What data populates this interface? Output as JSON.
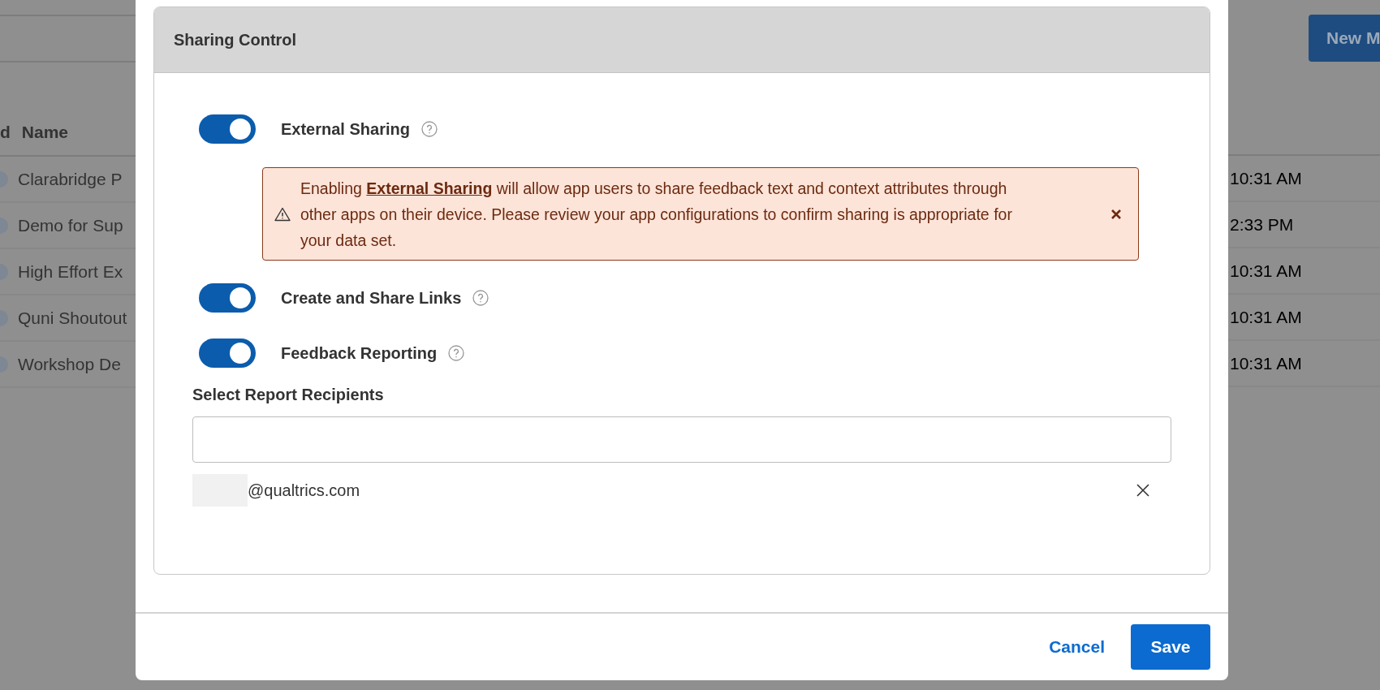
{
  "background": {
    "header_cells": [
      "d",
      "Name"
    ],
    "new_button": "New M",
    "rows": [
      {
        "name": "Clarabridge P",
        "time": "10:31 AM"
      },
      {
        "name": "Demo for Sup",
        "time": "2:33 PM"
      },
      {
        "name": "High Effort Ex",
        "time": "10:31 AM"
      },
      {
        "name": "Quni Shoutout",
        "time": "10:31 AM"
      },
      {
        "name": "Workshop De",
        "time": "10:31 AM"
      }
    ]
  },
  "dialog": {
    "card_title": "Sharing Control",
    "toggles": [
      {
        "label": "External Sharing",
        "on": true,
        "alert": "Enabling **External Sharing** will allow app users to share feedback text and context attributes through other apps on their device. Please review your app configurations to confirm sharing is appropriate for your data set."
      },
      {
        "label": "Create and Share Links",
        "on": true
      },
      {
        "label": "Feedback Reporting",
        "on": true
      }
    ],
    "recipients": {
      "label": "Select Report Recipients",
      "emails": [
        "@qualtrics.com"
      ]
    },
    "buttons": {
      "cancel": "Cancel",
      "save": "Save"
    }
  }
}
